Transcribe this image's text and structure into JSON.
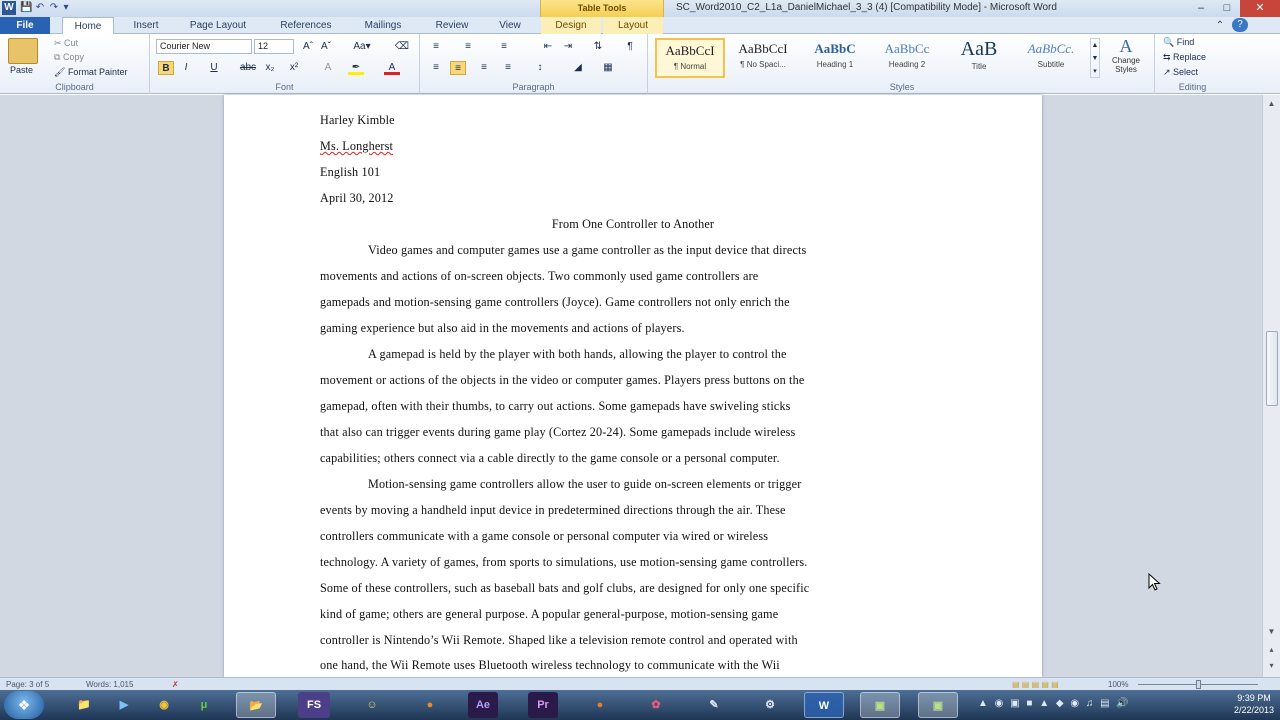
{
  "window": {
    "title": "SC_Word2010_C2_L1a_DanielMichael_3_3 (4) [Compatibility Mode] - Microsoft Word",
    "app_icon": "W",
    "context_tab_group": "Table Tools"
  },
  "ribbon_tabs": [
    {
      "label": "File"
    },
    {
      "label": "Home"
    },
    {
      "label": "Insert"
    },
    {
      "label": "Page Layout"
    },
    {
      "label": "References"
    },
    {
      "label": "Mailings"
    },
    {
      "label": "Review"
    },
    {
      "label": "View"
    },
    {
      "label": "Design"
    },
    {
      "label": "Layout"
    }
  ],
  "clipboard": {
    "paste": "Paste",
    "cut": "Cut",
    "copy": "Copy",
    "format_painter": "Format Painter",
    "group_label": "Clipboard"
  },
  "font": {
    "name": "Courier New",
    "size": "12",
    "group_label": "Font"
  },
  "paragraph": {
    "group_label": "Paragraph"
  },
  "styles": {
    "items": [
      {
        "sample": "AaBbCcI",
        "name": "¶ Normal"
      },
      {
        "sample": "AaBbCcI",
        "name": "¶ No Spaci..."
      },
      {
        "sample": "AaBbC",
        "name": "Heading 1"
      },
      {
        "sample": "AaBbCc",
        "name": "Heading 2"
      },
      {
        "sample": "AaB",
        "name": "Title"
      },
      {
        "sample": "AaBbCc.",
        "name": "Subtitle"
      }
    ],
    "change_styles": "Change Styles",
    "group_label": "Styles"
  },
  "editing": {
    "find": "Find",
    "replace": "Replace",
    "select": "Select",
    "group_label": "Editing"
  },
  "document": {
    "header_lines": [
      "Harley Kimble",
      "Ms. Longherst",
      "English 101",
      "April 30, 2012"
    ],
    "title": "From One Controller to Another",
    "body_lines": [
      "Video games and computer games use a game controller as the input device that directs",
      "movements and actions of on-screen objects. Two commonly used game controllers are",
      "gamepads and motion-sensing game controllers (Joyce). Game controllers not only enrich the",
      "gaming experience but also aid in the movements and actions of players.",
      "A gamepad is held by the player with both hands, allowing the player to control the",
      "movement or actions of the objects in the video or computer games. Players press buttons on the",
      "gamepad, often with their thumbs, to carry out actions. Some gamepads have swiveling sticks",
      "that also can trigger events during game play (Cortez 20-24). Some gamepads include wireless",
      "capabilities; others connect via a cable directly to the game console or a personal computer.",
      "Motion-sensing game controllers allow the user to guide on-screen elements or trigger",
      "events by moving a handheld input device in predetermined directions through the air. These",
      "controllers communicate with a game console or personal computer via wired or wireless",
      "technology. A variety of games, from sports to simulations, use motion-sensing game controllers.",
      "Some of these controllers, such as baseball bats and golf clubs, are designed for only one specific",
      "kind of game; others are general purpose. A popular general-purpose, motion-sensing game",
      "controller is Nintendo’s Wii Remote. Shaped like a television remote control and operated with",
      "one hand, the Wii Remote uses Bluetooth wireless technology to communicate with the Wii"
    ]
  },
  "status_bar": {
    "page": "Page: 3 of 5",
    "words": "Words: 1,015",
    "zoom": "100%"
  },
  "taskbar": {
    "apps": [
      "explorer",
      "media-player",
      "chrome",
      "utorrent",
      "folder",
      "FS",
      "app",
      "firefox",
      "Ae",
      "Pr",
      "app",
      "picasa",
      "tool",
      "steam",
      "W",
      "app",
      "app"
    ],
    "time": "9:39 PM",
    "date": "2/22/2013"
  }
}
